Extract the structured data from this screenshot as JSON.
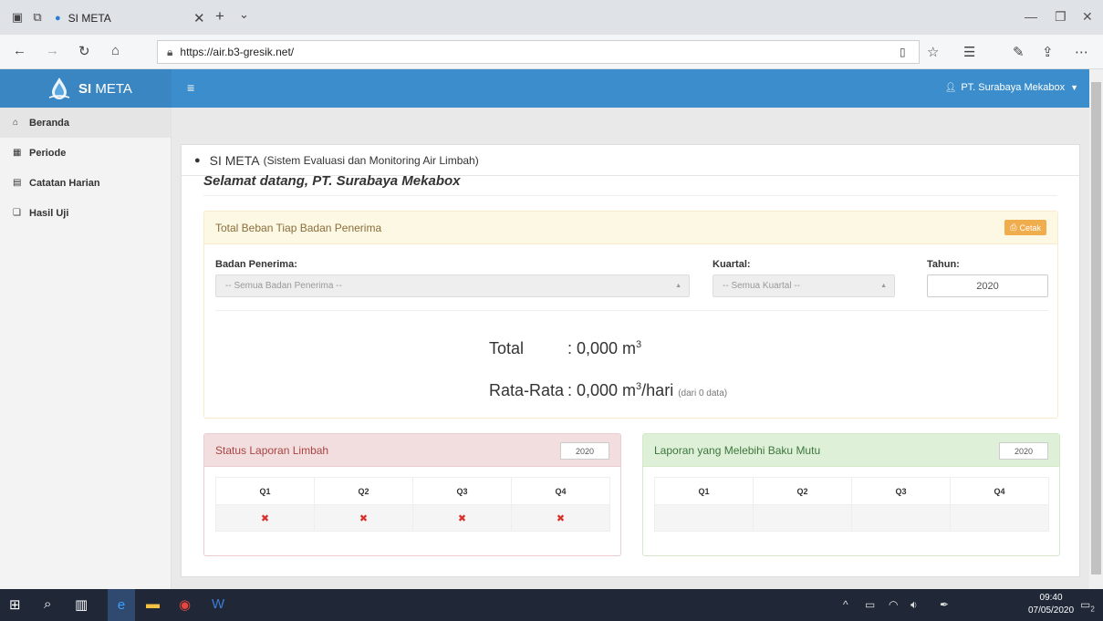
{
  "browser": {
    "tab_title": "SI META",
    "url": "https://air.b3-gresik.net/",
    "new_tab_glyph": "+",
    "tab_list_glyph": "⌄"
  },
  "app": {
    "brand_prefix": "SI",
    "brand_suffix": "META",
    "user_name": "PT. Surabaya Mekabox"
  },
  "sidebar": {
    "items": [
      {
        "label": "Beranda",
        "icon": "home-icon",
        "active": true
      },
      {
        "label": "Periode",
        "icon": "calendar-icon",
        "active": false
      },
      {
        "label": "Catatan Harian",
        "icon": "book-icon",
        "active": false
      },
      {
        "label": "Hasil Uji",
        "icon": "copy-icon",
        "active": false
      }
    ]
  },
  "main": {
    "title": "SI META",
    "subtitle": "(Sistem Evaluasi dan Monitoring Air Limbah)",
    "welcome": "Selamat datang, PT. Surabaya Mekabox"
  },
  "beban": {
    "header": "Total Beban Tiap Badan Penerima",
    "print_label": "Cetak",
    "badan_label": "Badan Penerima:",
    "badan_value": "-- Semua Badan Penerima --",
    "kuartal_label": "Kuartal:",
    "kuartal_value": "-- Semua Kuartal --",
    "tahun_label": "Tahun:",
    "tahun_value": "2020",
    "total_label": "Total",
    "total_value": ": 0,000 m",
    "total_exp": "3",
    "rata_label": "Rata-Rata",
    "rata_value": ": 0,000 m",
    "rata_exp": "3",
    "rata_unit": "/hari",
    "rata_note": "(dari 0 data)"
  },
  "status": {
    "title": "Status Laporan Limbah",
    "year": "2020",
    "headers": [
      "Q1",
      "Q2",
      "Q3",
      "Q4"
    ],
    "cells": [
      "✖",
      "✖",
      "✖",
      "✖"
    ]
  },
  "baku": {
    "title": "Laporan yang Melebihi Baku Mutu",
    "year": "2020",
    "headers": [
      "Q1",
      "Q2",
      "Q3",
      "Q4"
    ],
    "cells": [
      "",
      "",
      "",
      ""
    ]
  },
  "taskbar": {
    "time": "09:40",
    "date": "07/05/2020",
    "notif_count": "2"
  },
  "colors": {
    "header_blue": "#3b8dcc",
    "warning_bg": "#fcf8e3",
    "danger_bg": "#f2dede",
    "success_bg": "#dff0d8"
  }
}
